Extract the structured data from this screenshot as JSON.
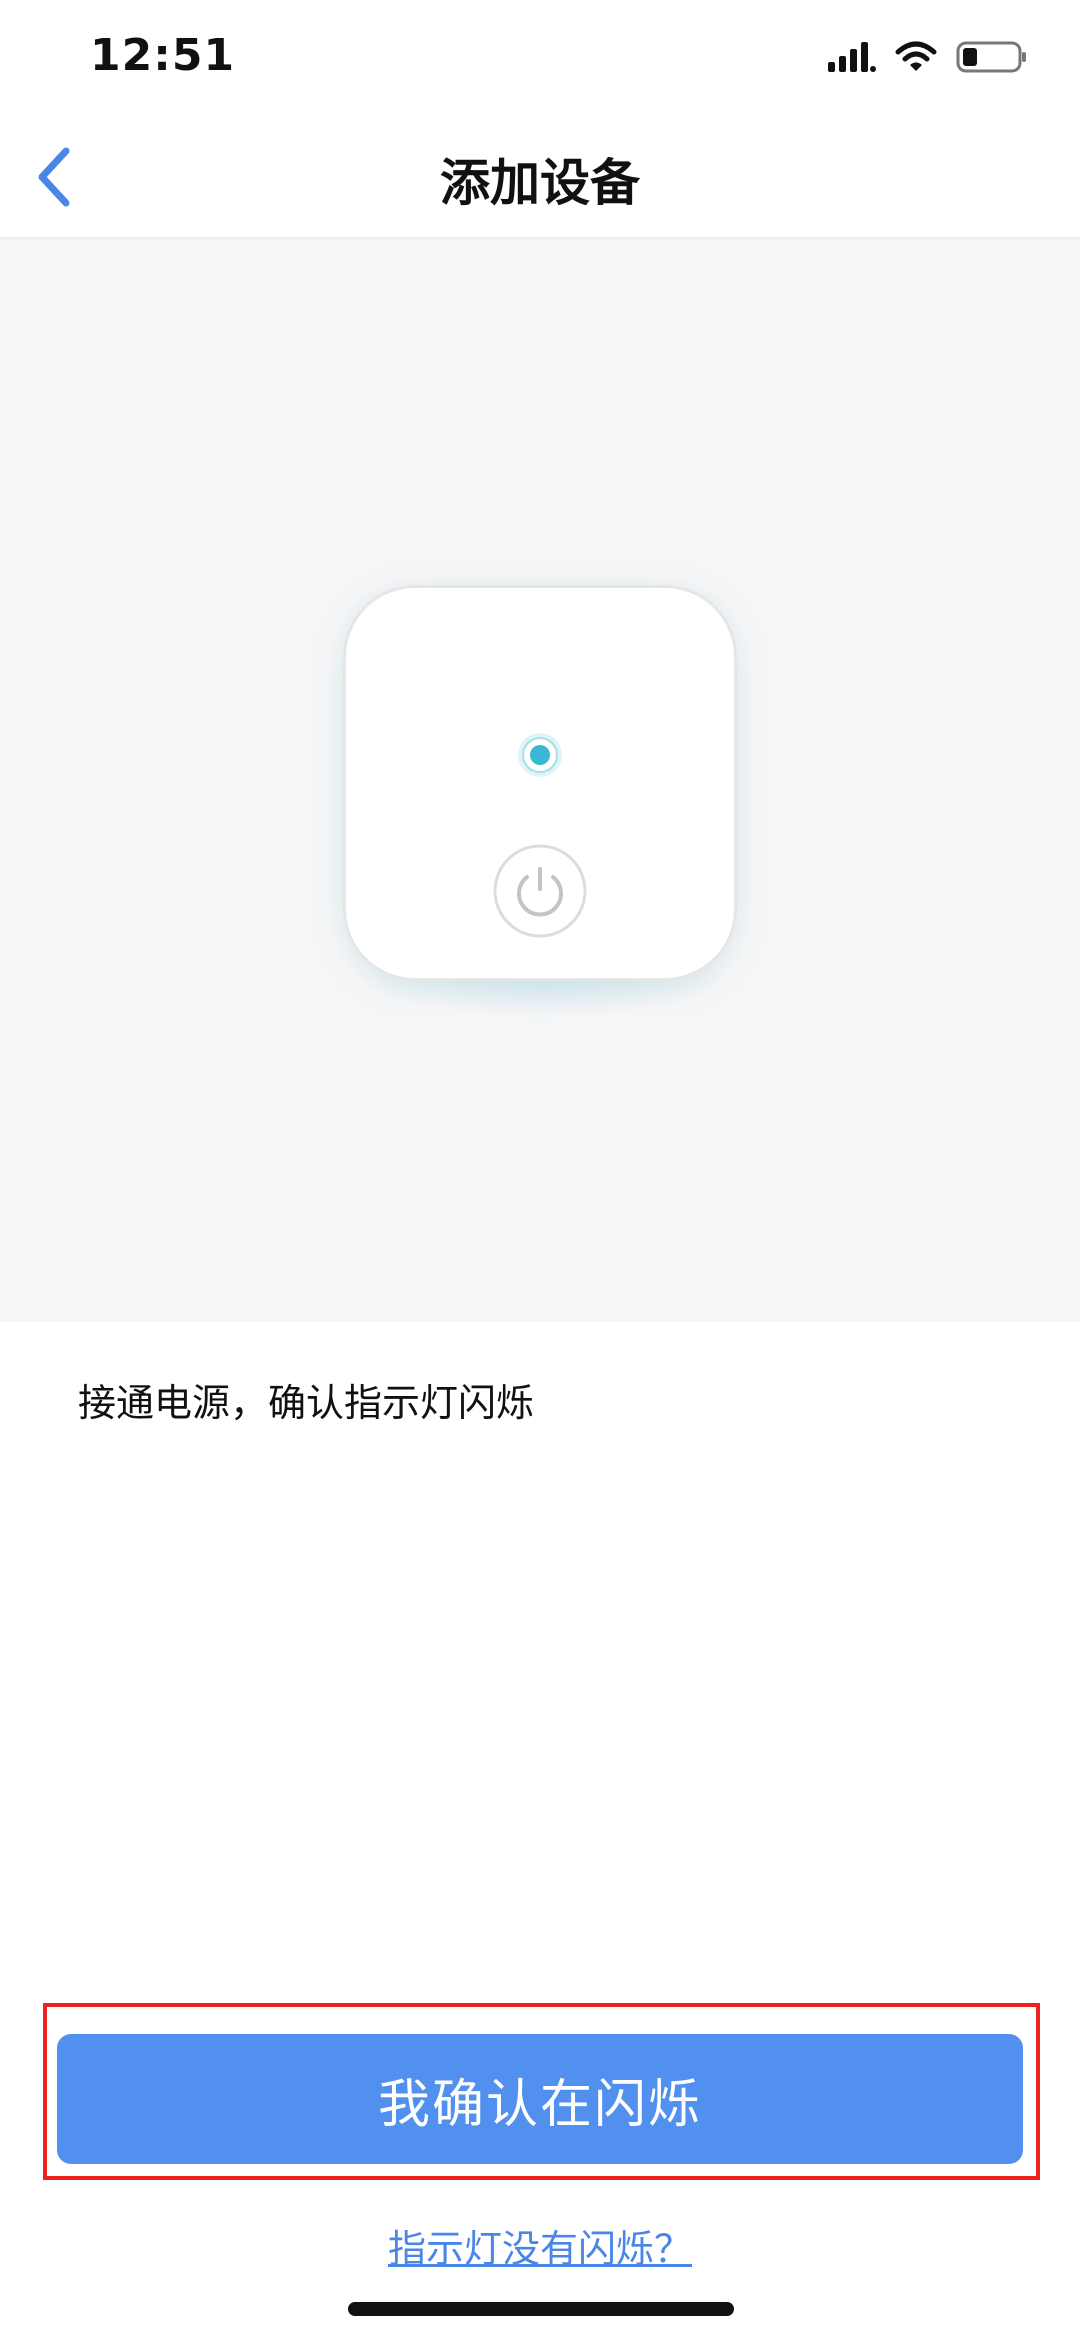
{
  "status_bar": {
    "time": "12:51",
    "icons": [
      "cellular-signal-icon",
      "wifi-icon",
      "battery-icon"
    ]
  },
  "nav": {
    "title": "添加设备",
    "back_icon": "chevron-left-icon"
  },
  "illustration": {
    "device": "power-device",
    "indicator_color": "#3bb7d6",
    "icons": [
      "indicator-light-icon",
      "power-icon"
    ]
  },
  "instruction": {
    "text": "接通电源，确认指示灯闪烁"
  },
  "confirm_button": {
    "label": "我确认在闪烁"
  },
  "help_link": {
    "label": "指示灯没有闪烁？"
  },
  "colors": {
    "accent": "#5290ef",
    "link": "#4a86e8",
    "highlight": "#ee2222"
  }
}
